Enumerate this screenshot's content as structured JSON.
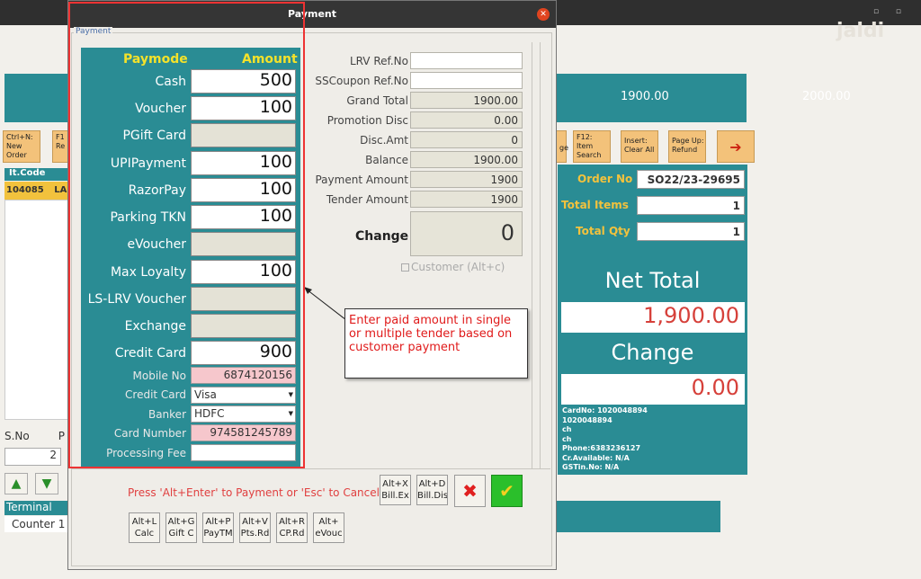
{
  "background": {
    "logo": "jaldi",
    "band_values": [
      "1900.00",
      "2000.00"
    ],
    "toolbar_buttons": [
      "Ctrl+N:\nNew\nOrder",
      "F1\nRe",
      "ge",
      "F12:\nItem\nSearch",
      "Insert:\nClear All",
      "Page Up:\nRefund"
    ],
    "table_header": "It.Code",
    "table_row_code": "104085",
    "table_row_partial": "LA",
    "order_no_label": "Order No",
    "order_no_value": "SO22/23-29695",
    "total_items_label": "Total Items",
    "total_items_value": "1",
    "total_qty_label": "Total Qty",
    "total_qty_value": "1",
    "net_total_label": "Net Total",
    "net_total_value": "1,900.00",
    "change_label": "Change",
    "change_value": "0.00",
    "customer_info": [
      "CardNo: 1020048894",
      "1020048894",
      "ch",
      "ch",
      "Phone:6383236127",
      "Cr.Available: N/A",
      "GSTin.No: N/A"
    ],
    "sno_label": "S.No",
    "sno_partial": "P",
    "sno_value": "2",
    "terminal_label": "Terminal",
    "terminal_value": "Counter 1"
  },
  "dialog": {
    "title": "Payment",
    "group_label": "Payment",
    "paymode_header": "Paymode",
    "amount_header": "Amount",
    "tenders": [
      {
        "label": "Cash",
        "value": "500",
        "style": "white"
      },
      {
        "label": "Voucher",
        "value": "100",
        "style": "white"
      },
      {
        "label": "PGift Card",
        "value": "",
        "style": "grey"
      },
      {
        "label": "UPIPayment",
        "value": "100",
        "style": "white"
      },
      {
        "label": "RazorPay",
        "value": "100",
        "style": "white"
      },
      {
        "label": "Parking TKN",
        "value": "100",
        "style": "white"
      },
      {
        "label": "eVoucher",
        "value": "",
        "style": "grey"
      },
      {
        "label": "Max Loyalty",
        "value": "100",
        "style": "white"
      },
      {
        "label": "LS-LRV Voucher",
        "value": "",
        "style": "grey"
      },
      {
        "label": "Exchange",
        "value": "",
        "style": "grey"
      },
      {
        "label": "Credit Card",
        "value": "900",
        "style": "white"
      }
    ],
    "card_fields": {
      "mobile_no_label": "Mobile No",
      "mobile_no_value": "6874120156",
      "credit_card_label": "Credit Card",
      "credit_card_value": "Visa",
      "banker_label": "Banker",
      "banker_value": "HDFC",
      "card_number_label": "Card Number",
      "card_number_value": "974581245789",
      "processing_fee_label": "Processing Fee",
      "processing_fee_value": ""
    },
    "summary": [
      {
        "label": "LRV Ref.No",
        "value": "",
        "style": "white"
      },
      {
        "label": "SSCoupon Ref.No",
        "value": "",
        "style": "white"
      },
      {
        "label": "Grand Total",
        "value": "1900.00",
        "style": "grey"
      },
      {
        "label": "Promotion Disc",
        "value": "0.00",
        "style": "grey"
      },
      {
        "label": "Disc.Amt",
        "value": "0",
        "style": "grey"
      },
      {
        "label": "Balance",
        "value": "1900.00",
        "style": "grey"
      },
      {
        "label": "Payment Amount",
        "value": "1900",
        "style": "grey"
      },
      {
        "label": "Tender Amount",
        "value": "1900",
        "style": "grey"
      }
    ],
    "change_label": "Change",
    "change_value": "0",
    "customer_checkbox": "Customer (Alt+c)",
    "callout_text": "Enter paid amount in single or multiple tender based on customer payment",
    "hint": "Press 'Alt+Enter' to Payment or 'Esc' to Cancel",
    "shortcut_buttons_top": [
      "Alt+X\nBill.Ex",
      "Alt+D\nBill.Dis"
    ],
    "shortcut_buttons_bottom": [
      "Alt+L\nCalc",
      "Alt+G\nGift C",
      "Alt+P\nPayTM",
      "Alt+V\nPts.Rd",
      "Alt+R\nCP.Rd",
      "Alt+\neVouc"
    ],
    "cancel_icon": "close-x-icon",
    "ok_icon": "checkmark-icon"
  }
}
